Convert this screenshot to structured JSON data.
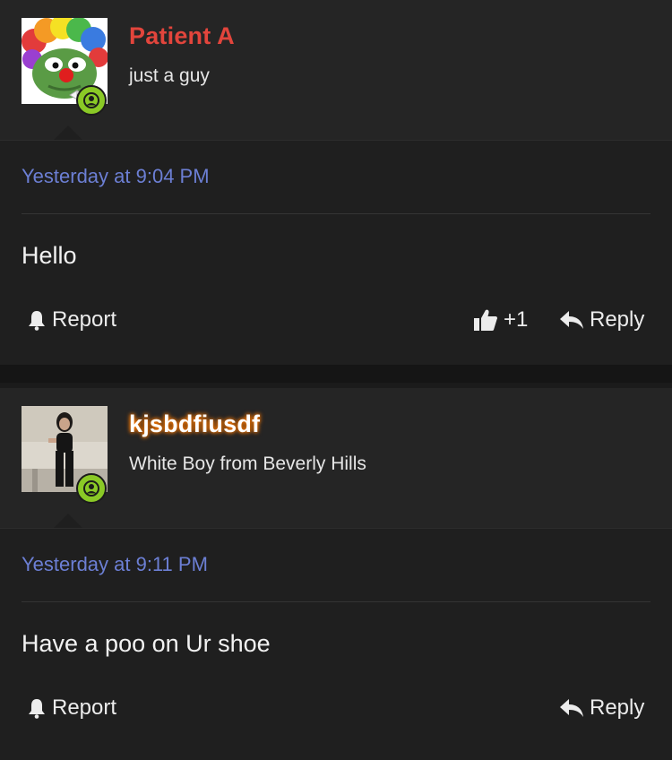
{
  "posts": [
    {
      "username": "Patient A",
      "username_color": "#e2453c",
      "user_title": "just a guy",
      "timestamp": "Yesterday at 9:04 PM",
      "message": "Hello",
      "report_label": "Report",
      "like_count": "+1",
      "reply_label": "Reply"
    },
    {
      "username": "kjsbdfiusdf",
      "username_color": "#ffffff",
      "username_glow": "#ff7a00",
      "user_title": "White Boy from Beverly Hills",
      "timestamp": "Yesterday at 9:11 PM",
      "message": "Have a poo on Ur shoe",
      "report_label": "Report",
      "reply_label": "Reply"
    }
  ],
  "icons": {
    "status": "user-online-icon",
    "report": "bell-icon",
    "like": "thumbs-up-icon",
    "reply": "reply-arrow-icon"
  }
}
